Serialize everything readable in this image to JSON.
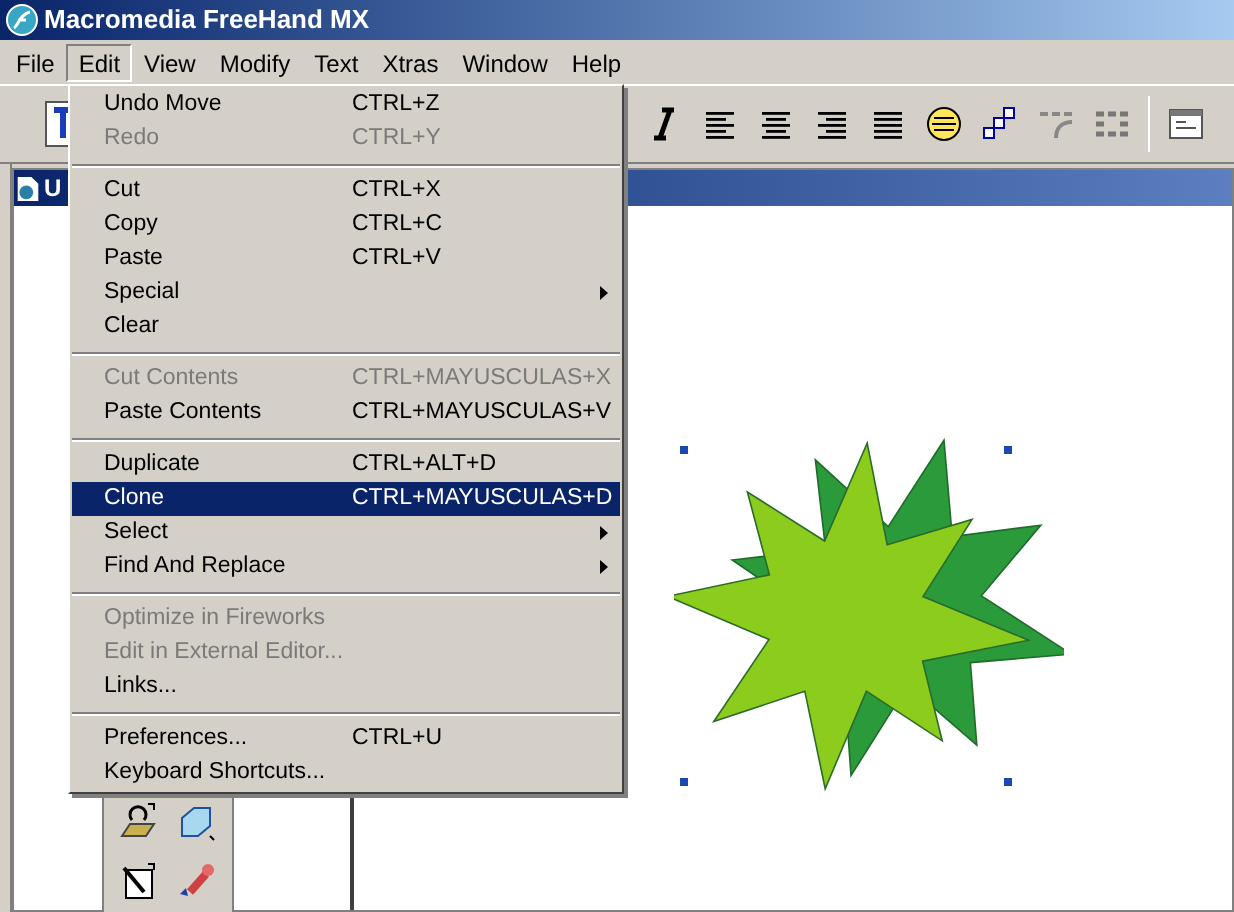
{
  "window": {
    "title": "Macromedia FreeHand MX"
  },
  "menubar": [
    {
      "label": "File",
      "selected": false
    },
    {
      "label": "Edit",
      "selected": true
    },
    {
      "label": "View",
      "selected": false
    },
    {
      "label": "Modify",
      "selected": false
    },
    {
      "label": "Text",
      "selected": false
    },
    {
      "label": "Xtras",
      "selected": false
    },
    {
      "label": "Window",
      "selected": false
    },
    {
      "label": "Help",
      "selected": false
    }
  ],
  "document": {
    "title": "U"
  },
  "edit_menu": [
    {
      "kind": "item",
      "label": "Undo Move",
      "shortcut": "CTRL+Z",
      "disabled": false,
      "selected": false,
      "submenu": false
    },
    {
      "kind": "item",
      "label": "Redo",
      "shortcut": "CTRL+Y",
      "disabled": true,
      "selected": false,
      "submenu": false
    },
    {
      "kind": "separator"
    },
    {
      "kind": "item",
      "label": "Cut",
      "shortcut": "CTRL+X",
      "disabled": false,
      "selected": false,
      "submenu": false
    },
    {
      "kind": "item",
      "label": "Copy",
      "shortcut": "CTRL+C",
      "disabled": false,
      "selected": false,
      "submenu": false
    },
    {
      "kind": "item",
      "label": "Paste",
      "shortcut": "CTRL+V",
      "disabled": false,
      "selected": false,
      "submenu": false
    },
    {
      "kind": "item",
      "label": "Special",
      "disabled": false,
      "selected": false,
      "submenu": true
    },
    {
      "kind": "item",
      "label": "Clear",
      "disabled": false,
      "selected": false,
      "submenu": false
    },
    {
      "kind": "separator"
    },
    {
      "kind": "item",
      "label": "Cut Contents",
      "shortcut": "CTRL+MAYUSCULAS+X",
      "disabled": true,
      "selected": false,
      "submenu": false
    },
    {
      "kind": "item",
      "label": "Paste Contents",
      "shortcut": "CTRL+MAYUSCULAS+V",
      "disabled": false,
      "selected": false,
      "submenu": false
    },
    {
      "kind": "separator"
    },
    {
      "kind": "item",
      "label": "Duplicate",
      "shortcut": "CTRL+ALT+D",
      "disabled": false,
      "selected": false,
      "submenu": false
    },
    {
      "kind": "item",
      "label": "Clone",
      "shortcut": "CTRL+MAYUSCULAS+D",
      "disabled": false,
      "selected": true,
      "submenu": false
    },
    {
      "kind": "item",
      "label": "Select",
      "disabled": false,
      "selected": false,
      "submenu": true
    },
    {
      "kind": "item",
      "label": "Find And Replace",
      "disabled": false,
      "selected": false,
      "submenu": true
    },
    {
      "kind": "separator"
    },
    {
      "kind": "item",
      "label": "Optimize in Fireworks",
      "disabled": true,
      "selected": false,
      "submenu": false
    },
    {
      "kind": "item",
      "label": "Edit in External Editor...",
      "disabled": true,
      "selected": false,
      "submenu": false
    },
    {
      "kind": "item",
      "label": "Links...",
      "disabled": false,
      "selected": false,
      "submenu": false
    },
    {
      "kind": "separator"
    },
    {
      "kind": "item",
      "label": "Preferences...",
      "shortcut": "CTRL+U",
      "disabled": false,
      "selected": false,
      "submenu": false
    },
    {
      "kind": "item",
      "label": "Keyboard Shortcuts...",
      "disabled": false,
      "selected": false,
      "submenu": false
    }
  ]
}
